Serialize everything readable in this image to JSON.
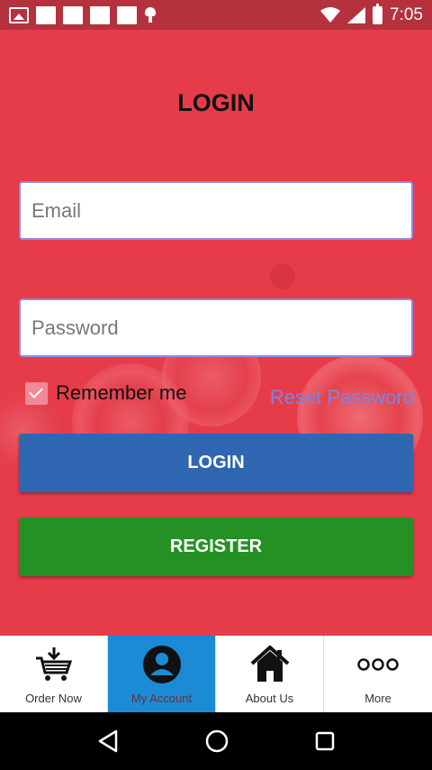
{
  "status_bar": {
    "time": "7:05"
  },
  "page": {
    "title": "LOGIN"
  },
  "form": {
    "email_placeholder": "Email",
    "password_placeholder": "Password",
    "remember_label": "Remember me",
    "reset_label": "Reset Password",
    "login_label": "LOGIN",
    "register_label": "REGISTER"
  },
  "bottom_nav": [
    {
      "label": "Order Now",
      "icon": "cart-icon"
    },
    {
      "label": "My Account",
      "icon": "account-icon",
      "active": true
    },
    {
      "label": "About Us",
      "icon": "home-icon"
    },
    {
      "label": "More",
      "icon": "more-icon"
    }
  ],
  "colors": {
    "background": "#e63c4a",
    "login_button": "#2f66b2",
    "register_button": "#259125",
    "active_tab": "#1b8bd6",
    "link": "#7b84e6"
  }
}
